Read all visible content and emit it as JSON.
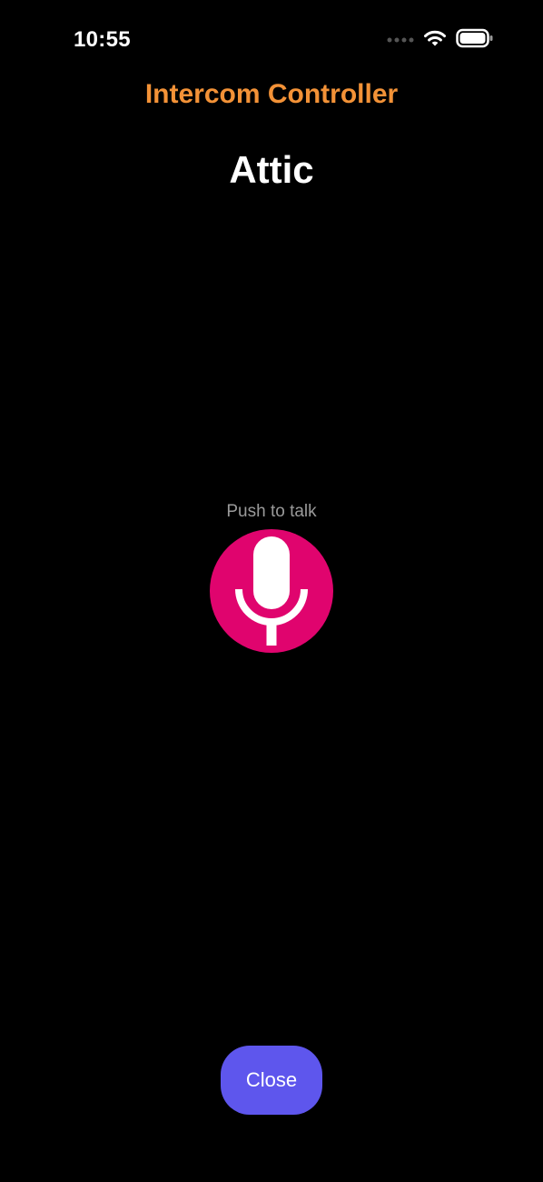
{
  "status_bar": {
    "time": "10:55",
    "icons": [
      "signal-dots-icon",
      "wifi-icon",
      "battery-icon"
    ]
  },
  "header": {
    "app_title": "Intercom Controller",
    "room_title": "Attic"
  },
  "main": {
    "push_to_talk_label": "Push to talk",
    "mic_icon": "microphone-icon"
  },
  "footer": {
    "close_label": "Close"
  },
  "colors": {
    "background": "#000000",
    "app_title": "#F39237",
    "mic_button": "#E0046E",
    "close_button": "#5E56ED",
    "secondary_text": "#9A9A9A"
  }
}
